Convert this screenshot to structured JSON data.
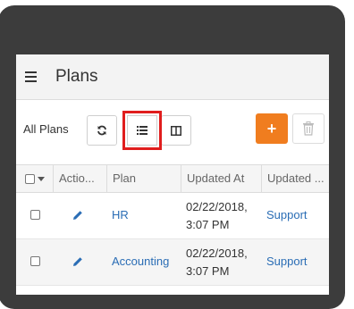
{
  "header": {
    "title": "Plans"
  },
  "toolbar": {
    "view_label": "All Plans",
    "add_label": "+"
  },
  "table": {
    "columns": [
      "Actio...",
      "Plan",
      "Updated At",
      "Updated ..."
    ],
    "rows": [
      {
        "plan": "HR",
        "updated_at_date": "02/22/2018,",
        "updated_at_time": "3:07 PM",
        "updated_by": "Support"
      },
      {
        "plan": "Accounting",
        "updated_at_date": "02/22/2018,",
        "updated_at_time": "3:07 PM",
        "updated_by": "Support"
      }
    ]
  },
  "icons": {
    "menu": "hamburger-menu-icon",
    "refresh": "refresh-icon",
    "list_view": "list-view-icon",
    "columns_view": "columns-view-icon",
    "add": "plus-icon",
    "delete": "trash-icon",
    "edit": "pencil-icon"
  },
  "colors": {
    "accent": "#f07d1f",
    "link": "#2a6db5",
    "highlight": "#e01d1d",
    "header_bg": "#f3f3f3",
    "device_frame": "#3c3c3c"
  }
}
